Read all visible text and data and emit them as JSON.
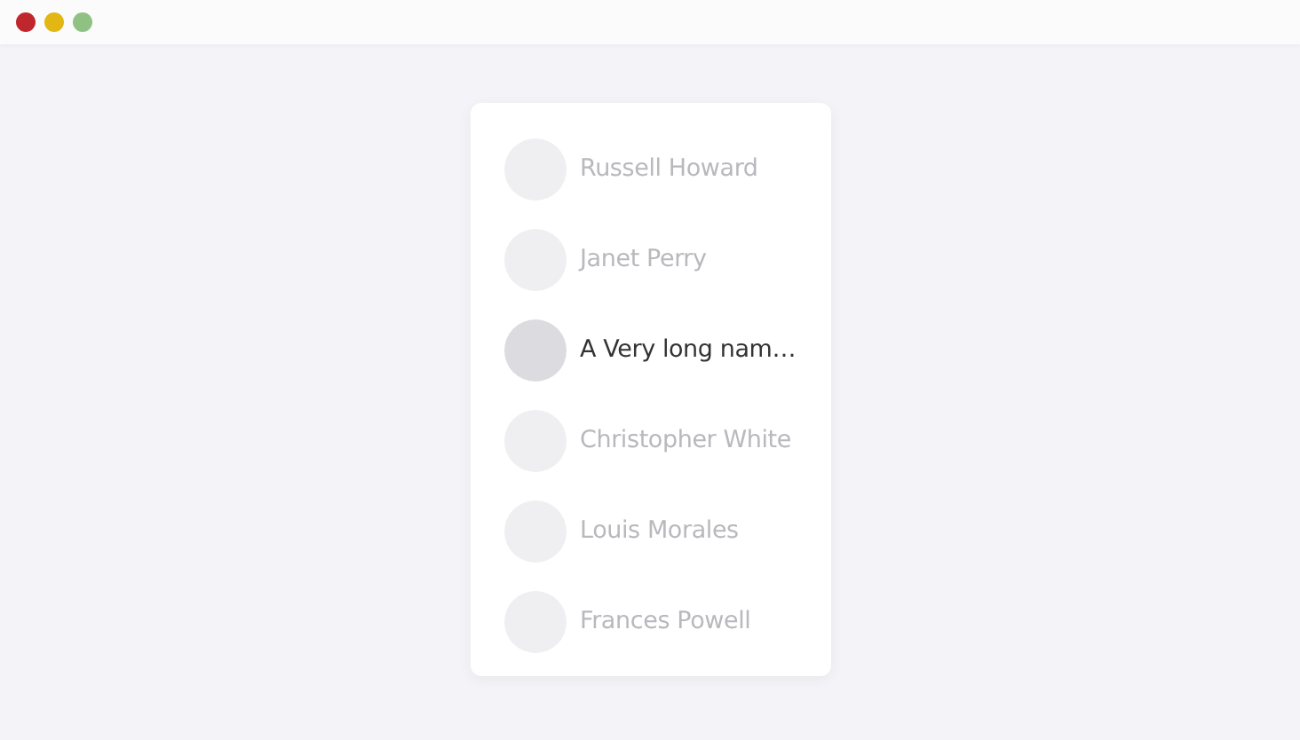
{
  "window_controls": [
    {
      "color": "#c0272d"
    },
    {
      "color": "#e2b714"
    },
    {
      "color": "#8fc183"
    }
  ],
  "contacts": [
    {
      "name": "Russell Howard",
      "selected": false
    },
    {
      "name": "Janet Perry",
      "selected": false
    },
    {
      "name": "A Very long nam…",
      "selected": true
    },
    {
      "name": "Christopher White",
      "selected": false
    },
    {
      "name": "Louis Morales",
      "selected": false
    },
    {
      "name": "Frances Powell",
      "selected": false
    }
  ]
}
